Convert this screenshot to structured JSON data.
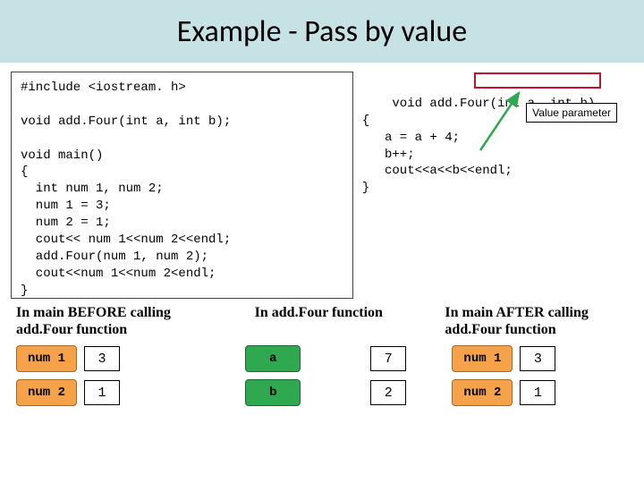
{
  "title": "Example - Pass by value",
  "code_left": "#include <iostream. h>\n\nvoid add.Four(int a, int b);\n\nvoid main()\n{\n  int num 1, num 2;\n  num 1 = 3;\n  num 2 = 1;\n  cout<< num 1<<num 2<<endl;\n  add.Four(num 1, num 2);\n  cout<<num 1<<num 2<endl;\n}",
  "code_right": "void add.Four(int a, int b)\n{\n   a = a + 4;\n   b++;\n   cout<<a<<b<<endl;\n}",
  "callout": "Value parameter",
  "captions": {
    "left": "In main BEFORE calling add.Four function",
    "mid": "In add.Four function",
    "right": "In main AFTER calling add.Four function"
  },
  "vars": {
    "left": [
      {
        "name": "num 1",
        "value": "3"
      },
      {
        "name": "num 2",
        "value": "1"
      }
    ],
    "mid": [
      {
        "name": "a",
        "value": "7"
      },
      {
        "name": "b",
        "value": "2"
      }
    ],
    "right": [
      {
        "name": "num 1",
        "value": "3"
      },
      {
        "name": "num 2",
        "value": "1"
      }
    ]
  }
}
